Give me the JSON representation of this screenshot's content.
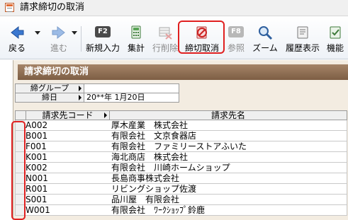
{
  "window": {
    "title": "請求締切の取消"
  },
  "toolbar": {
    "back_label": "戻る",
    "forward_label": "進む",
    "new_fkey": "F2",
    "new_label": "新規入力",
    "total_label": "集計",
    "delete_label": "行削除",
    "cancel_close_label": "締切取消",
    "ref_fkey": "F8",
    "ref_label": "参照",
    "zoom_label": "ズーム",
    "history_label": "履歴表示",
    "function_label": "機能"
  },
  "panel": {
    "title": "請求締切の取消",
    "filter": {
      "group_label": "締グループ",
      "group_value": "",
      "date_label": "締日",
      "date_value": "20**年 1月20日"
    },
    "table": {
      "col_code": "請求先コード",
      "col_name": "請求先名",
      "rows": [
        {
          "code": "A002",
          "name": "厚木産業　株式会社"
        },
        {
          "code": "B001",
          "name": "有限会社　文京食器店"
        },
        {
          "code": "F001",
          "name": "有限会社　ファミリーストアふいた"
        },
        {
          "code": "K001",
          "name": "海北商店　株式会社"
        },
        {
          "code": "K002",
          "name": "有限会社　川崎ホームショップ"
        },
        {
          "code": "N001",
          "name": "長島商事株式会社"
        },
        {
          "code": "R001",
          "name": "リビングショップ佐渡"
        },
        {
          "code": "S001",
          "name": "品川屋　有限会社"
        },
        {
          "code": "W001",
          "name": "有限会社　ﾜｰｸｼｮｯﾌﾟ鈴鹿"
        }
      ]
    }
  },
  "colors": {
    "accent": "#e02020",
    "header": "#8c6b50",
    "panel_bg": "#f3ece1"
  }
}
